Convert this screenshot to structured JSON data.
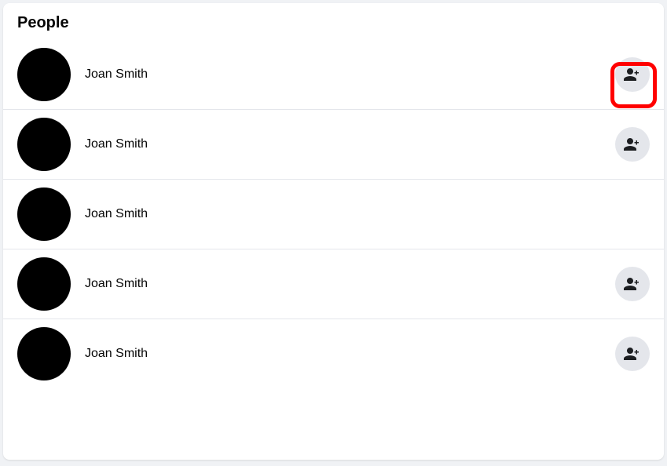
{
  "section_title": "People",
  "people": [
    {
      "name": "Joan Smith",
      "has_add_button": true,
      "highlighted": true
    },
    {
      "name": "Joan Smith",
      "has_add_button": true,
      "highlighted": false
    },
    {
      "name": "Joan Smith",
      "has_add_button": false,
      "highlighted": false
    },
    {
      "name": "Joan Smith",
      "has_add_button": true,
      "highlighted": false
    },
    {
      "name": "Joan Smith",
      "has_add_button": true,
      "highlighted": false
    }
  ],
  "icons": {
    "add_friend": "add-friend-icon"
  },
  "highlight_color": "#ff0000"
}
